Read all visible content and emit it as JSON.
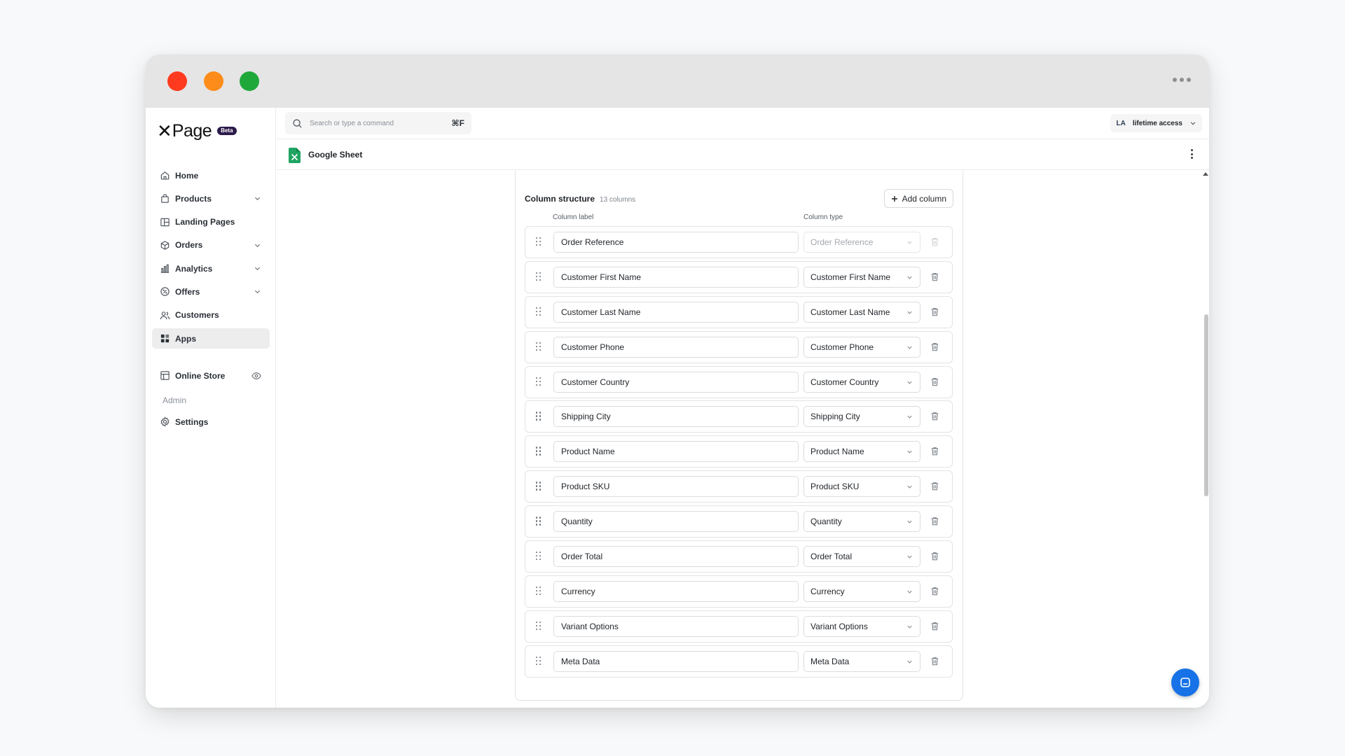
{
  "brand": {
    "logo_text": "Page",
    "badge": "Beta"
  },
  "sidebar": {
    "items": [
      {
        "label": "Home",
        "icon": "home-icon"
      },
      {
        "label": "Products",
        "icon": "bag-icon",
        "expandable": true
      },
      {
        "label": "Landing Pages",
        "icon": "layout-icon"
      },
      {
        "label": "Orders",
        "icon": "box-icon",
        "expandable": true
      },
      {
        "label": "Analytics",
        "icon": "bar-chart-icon",
        "expandable": true
      },
      {
        "label": "Offers",
        "icon": "discount-icon",
        "expandable": true
      },
      {
        "label": "Customers",
        "icon": "users-icon"
      },
      {
        "label": "Apps",
        "icon": "apps-icon",
        "active": true
      }
    ],
    "store": {
      "label": "Online Store",
      "icon": "store-icon"
    },
    "admin_section": "Admin",
    "settings": {
      "label": "Settings",
      "icon": "gear-icon"
    }
  },
  "topbar": {
    "search_placeholder": "Search or type a command",
    "shortcut": "⌘F",
    "account_initials": "LA",
    "account_label": "lifetime access"
  },
  "subbar": {
    "title": "Google Sheet"
  },
  "column_structure": {
    "title": "Column structure",
    "count": "13 columns",
    "add_button": "Add column",
    "header_label": "Column label",
    "header_type": "Column type",
    "rows": [
      {
        "label": "Order Reference",
        "type": "Order Reference",
        "locked": true
      },
      {
        "label": "Customer First Name",
        "type": "Customer First Name"
      },
      {
        "label": "Customer Last Name",
        "type": "Customer Last Name"
      },
      {
        "label": "Customer Phone",
        "type": "Customer Phone"
      },
      {
        "label": "Customer Country",
        "type": "Customer Country"
      },
      {
        "label": "Shipping City",
        "type": "Shipping City"
      },
      {
        "label": "Product Name",
        "type": "Product Name"
      },
      {
        "label": "Product SKU",
        "type": "Product SKU"
      },
      {
        "label": "Quantity",
        "type": "Quantity"
      },
      {
        "label": "Order Total",
        "type": "Order Total"
      },
      {
        "label": "Currency",
        "type": "Currency"
      },
      {
        "label": "Variant Options",
        "type": "Variant Options"
      },
      {
        "label": "Meta Data",
        "type": "Meta Data"
      }
    ]
  },
  "colors": {
    "accent_blue": "#1672e6",
    "sheet_green": "#1fa463",
    "dot_red": "#fe3b1f",
    "dot_orange": "#fe8c1a",
    "dot_green": "#1fa83a"
  }
}
